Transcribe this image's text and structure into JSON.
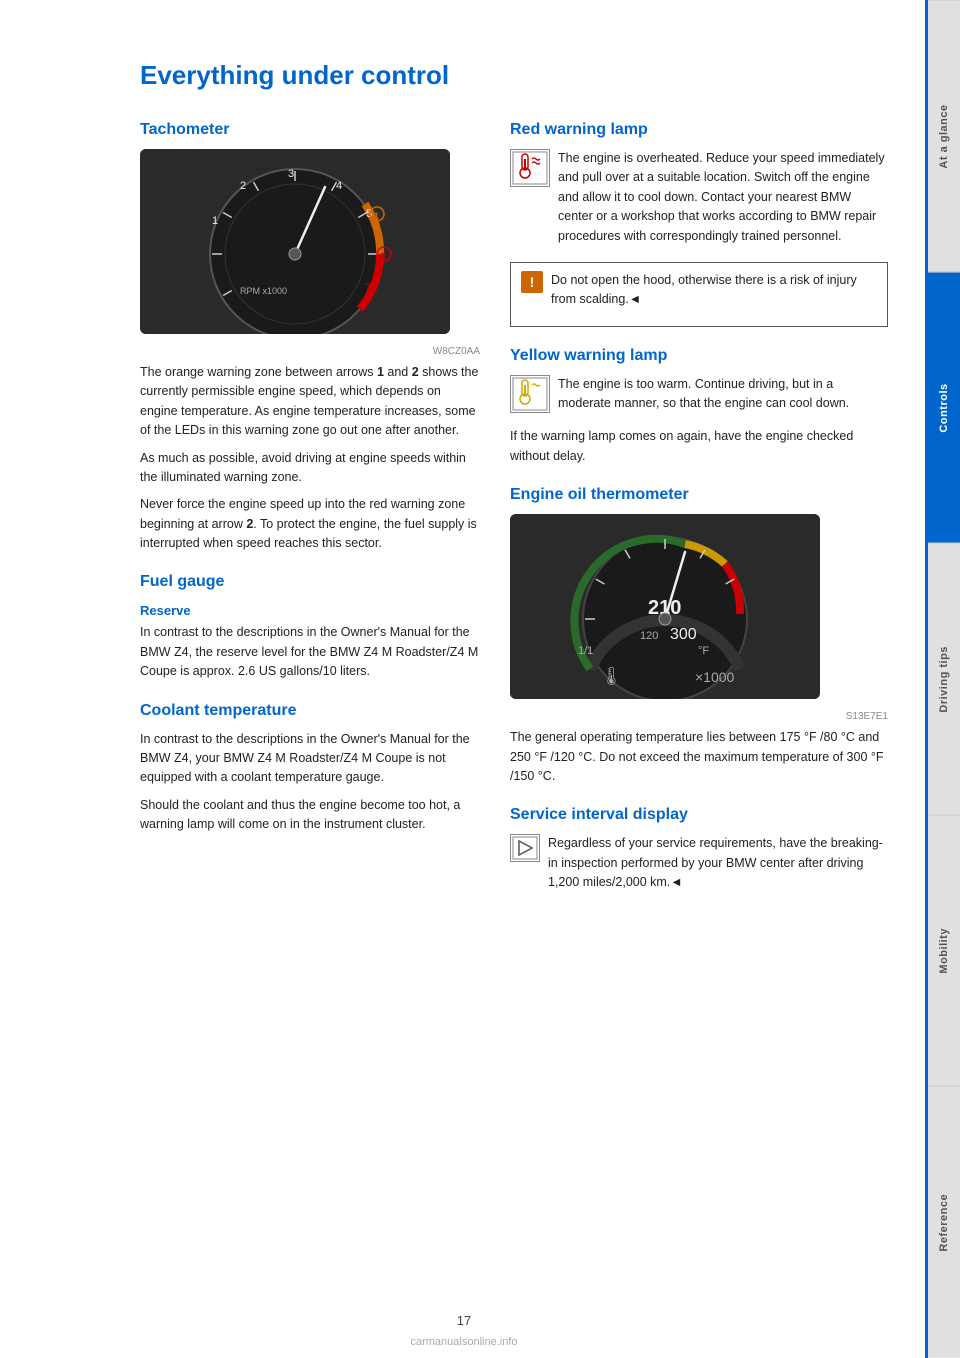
{
  "page": {
    "title": "Everything under control",
    "number": "17",
    "watermark": "carmanualsonline.info"
  },
  "sidebar": {
    "tabs": [
      {
        "id": "at-a-glance",
        "label": "At a glance",
        "active": false
      },
      {
        "id": "controls",
        "label": "Controls",
        "active": true
      },
      {
        "id": "driving-tips",
        "label": "Driving tips",
        "active": false
      },
      {
        "id": "mobility",
        "label": "Mobility",
        "active": false
      },
      {
        "id": "reference",
        "label": "Reference",
        "active": false
      }
    ]
  },
  "sections": {
    "tachometer": {
      "heading": "Tachometer",
      "body1": "The orange warning zone between arrows 1 and 2 shows the currently permissible engine speed, which depends on engine temperature. As engine temperature increases, some of the LEDs in this warning zone go out one after another.",
      "body2": "As much as possible, avoid driving at engine speeds within the illuminated warning zone.",
      "body3": "Never force the engine speed up into the red warning zone beginning at arrow 2. To protect the engine, the fuel supply is interrupted when speed reaches this sector."
    },
    "fuel_gauge": {
      "heading": "Fuel gauge",
      "subheading": "Reserve",
      "body": "In contrast to the descriptions in the Owner's Manual for the BMW Z4, the reserve level for the BMW Z4 M Roadster/Z4 M Coupe is approx. 2.6 US gallons/10 liters."
    },
    "coolant": {
      "heading": "Coolant temperature",
      "body1": "In contrast to the descriptions in the Owner's Manual for the BMW Z4, your BMW Z4 M Roadster/Z4 M Coupe is not equipped with a coolant temperature gauge.",
      "body2": "Should the coolant and thus the engine become too hot, a warning lamp will come on in the instrument cluster."
    },
    "red_warning": {
      "heading": "Red warning lamp",
      "body": "The engine is overheated. Reduce your speed immediately and pull over at a suitable location. Switch off the engine and allow it to cool down. Contact your nearest BMW center or a workshop that works according to BMW repair procedures with correspondingly trained personnel.",
      "warning_box": "Do not open the hood, otherwise there is a risk of injury from scalding.◄"
    },
    "yellow_warning": {
      "heading": "Yellow warning lamp",
      "body1": "The engine is too warm. Continue driving, but in a moderate manner, so that the engine can cool down.",
      "body2": "If the warning lamp comes on again, have the engine checked without delay."
    },
    "oil_thermo": {
      "heading": "Engine oil thermometer",
      "body1": "The general operating temperature lies between 175 °F /80 °C and 250 °F /120 °C. Do not exceed the maximum temperature of 300 °F /150 °C."
    },
    "service_interval": {
      "heading": "Service interval display",
      "body": "Regardless of your service requirements, have the breaking-in inspection performed by your BMW center after driving 1,200 miles/2,000 km.◄"
    }
  }
}
